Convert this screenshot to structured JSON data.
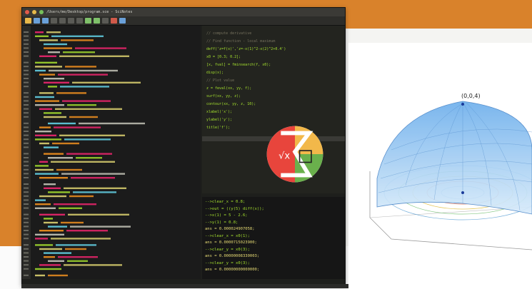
{
  "window": {
    "title": "/Users/me/Desktop/program.sce - SciNotes"
  },
  "console": {
    "lines": [
      "-->clear_x = 0.8;",
      "-->out = ((y(5) diff(x));",
      "-->x(1) = 5 - 2.6;",
      "-->y(1) = 0.8;",
      "ans = 0.000024907058;",
      "-->clear_x = x0(1);",
      "ans = 0.0000715023900;",
      "-->clear_y = x0(3);",
      "ans = 0.00000008330003;",
      "-->clear_y = x0(3);",
      "ans = 0.00000000000000;"
    ]
  },
  "editor_right": {
    "lines": [
      "// compute derivative",
      "// Find function - local maximum",
      "deff('z=f(x)','z=-x(1)^2-x(2)^2+0.4')",
      "x0 = [0.3; 0.2];",
      "[x, fval] = fminsearch(f, x0);",
      "disp(x);",
      "// Plot value",
      "z = feval(xx, yy, f);",
      "surf(xx, yy, z);",
      "contour(xx, yy, z, 10);",
      "xlabel('x');",
      "ylabel('y');",
      "title('f');"
    ]
  },
  "plot": {
    "peak_label": "(0,0,4)"
  },
  "colors": {
    "surface": "#7fb6e6",
    "surface_dark": "#3f7fc2",
    "orange": "#d9822b"
  }
}
